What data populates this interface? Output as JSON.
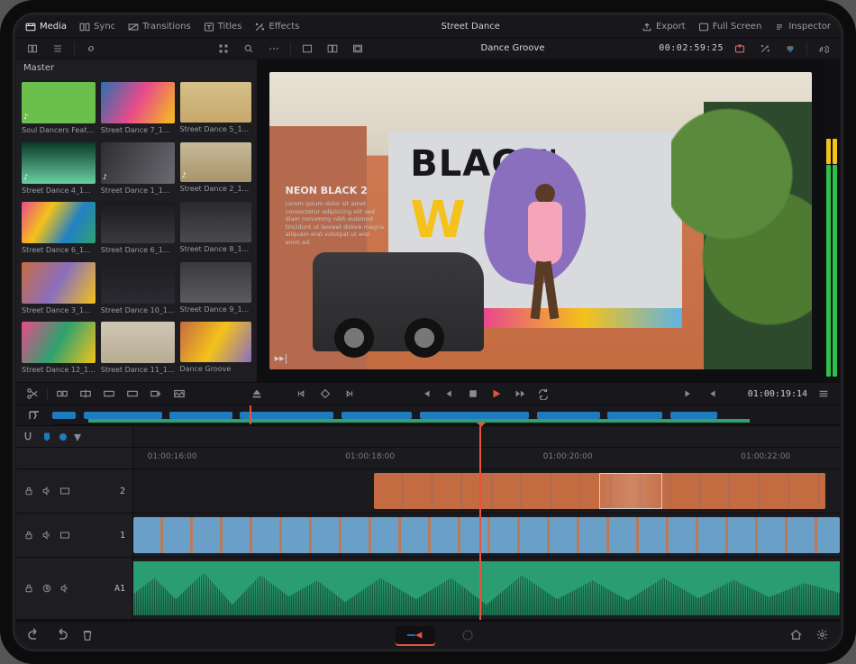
{
  "project_title": "Street Dance",
  "menu": {
    "media": "Media",
    "sync": "Sync",
    "transitions": "Transitions",
    "titles": "Titles",
    "effects": "Effects",
    "export": "Export",
    "fullscreen": "Full Screen",
    "inspector": "Inspector"
  },
  "viewer": {
    "clip_name": "Dance Groove",
    "clip_timecode": "00:02:59:25",
    "overlay_title": "NEON BLACK 2",
    "overlay_body": "Lorem ipsum dolor sit amet consectetur adipiscing elit sed diam nonummy nibh euismod tincidunt ut laoreet dolore magna aliquam erat volutpat ut wisi enim ad.",
    "mural_top": "BLACK'",
    "mural_bottom": "W   N"
  },
  "media": {
    "heading": "Master",
    "clips": [
      {
        "label": "Soul Dancers Feat...",
        "bg": "linear-gradient(#6bbf4d,#6bbf4d)",
        "music": true
      },
      {
        "label": "Street Dance 7_1...",
        "bg": "linear-gradient(120deg,#2a6fb0,#e94b8a,#f4c21a)"
      },
      {
        "label": "Street Dance 5_1...",
        "bg": "linear-gradient(#d6c08a,#c6a86a)"
      },
      {
        "label": "Street Dance 4_1...",
        "bg": "linear-gradient(#0a3a2a,#6ad0a0)",
        "music": true
      },
      {
        "label": "Street Dance 1_1...",
        "bg": "linear-gradient(120deg,#2d2d32,#6a6a70)",
        "music": true
      },
      {
        "label": "Street Dance 2_1...",
        "bg": "linear-gradient(#c6b89a,#a8966a)",
        "music": true
      },
      {
        "label": "Street Dance 6_1...",
        "bg": "linear-gradient(120deg,#e94b8a,#f4c21a,#2280c4,#2ea26e)"
      },
      {
        "label": "Street Dance 6_1...",
        "bg": "linear-gradient(#1a1a1d,#3a3a3d)"
      },
      {
        "label": "Street Dance 8_1...",
        "bg": "linear-gradient(#2a2a2e,#4a4a50)"
      },
      {
        "label": "Street Dance 3_1...",
        "bg": "linear-gradient(120deg,#c56b42,#8a6fbf,#f4c21a)"
      },
      {
        "label": "Street Dance 10_1...",
        "bg": "linear-gradient(#1d1d22,#2a2a30)"
      },
      {
        "label": "Street Dance 9_1...",
        "bg": "linear-gradient(#3a3a3d,#5a5a60)"
      },
      {
        "label": "Street Dance 12_1...",
        "bg": "linear-gradient(120deg,#e94b8a,#2ea26e,#f4c21a)"
      },
      {
        "label": "Street Dance 11_1...",
        "bg": "linear-gradient(#cfc6b4,#b8ac94)"
      },
      {
        "label": "Dance Groove",
        "bg": "linear-gradient(120deg,#c56b42,#f4c21a,#8a6fbf)"
      }
    ]
  },
  "transport": {
    "timecode": "01:00:19:14"
  },
  "timeline": {
    "ruler": [
      "01:00:16:00",
      "01:00:18:00",
      "01:00:20:00",
      "01:00:22:00"
    ],
    "tracks": {
      "v2": "2",
      "v1": "1",
      "a1": "A1"
    }
  },
  "meter": [
    {
      "h": 4,
      "c": "#f4c21a"
    },
    {
      "h": 4,
      "c": "#f4c21a"
    },
    {
      "h": 90,
      "c": "#2ea26e"
    },
    {
      "h": 92,
      "c": "#2ea26e"
    }
  ],
  "colors": {
    "accent": "#e5533c",
    "blue": "#1f7bbf",
    "green": "#2ea26e"
  }
}
